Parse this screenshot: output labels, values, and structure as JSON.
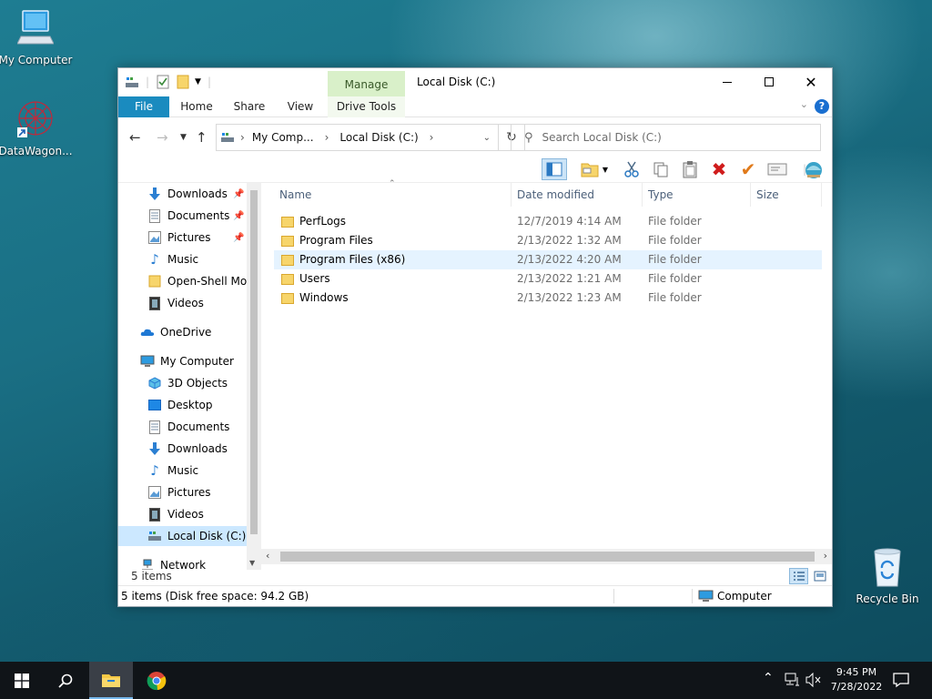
{
  "desktop": {
    "icons": [
      {
        "label": "My Computer"
      },
      {
        "label": "DataWagon..."
      },
      {
        "label": "Recycle Bin"
      }
    ]
  },
  "window": {
    "title": "Local Disk (C:)",
    "contextual_group": "Manage",
    "tabs": [
      "File",
      "Home",
      "Share",
      "View",
      "Drive Tools"
    ],
    "breadcrumb": [
      "My Comp...",
      "Local Disk (C:)"
    ],
    "search_placeholder": "Search Local Disk (C:)",
    "nav_items": [
      {
        "label": "Downloads",
        "icon": "downloads-icon",
        "pinned": true
      },
      {
        "label": "Documents",
        "icon": "documents-icon",
        "pinned": true
      },
      {
        "label": "Pictures",
        "icon": "pictures-icon",
        "pinned": true
      },
      {
        "label": "Music",
        "icon": "music-icon",
        "pinned": false
      },
      {
        "label": "Open-Shell Mod",
        "icon": "folder-icon",
        "pinned": false
      },
      {
        "label": "Videos",
        "icon": "videos-icon",
        "pinned": false
      },
      {
        "label": "OneDrive",
        "icon": "onedrive-icon",
        "pinned": false
      },
      {
        "label": "My Computer",
        "icon": "computer-icon",
        "pinned": false
      },
      {
        "label": "3D Objects",
        "icon": "3d-objects-icon",
        "pinned": false
      },
      {
        "label": "Desktop",
        "icon": "desktop-icon",
        "pinned": false
      },
      {
        "label": "Documents",
        "icon": "documents-icon",
        "pinned": false
      },
      {
        "label": "Downloads",
        "icon": "downloads-icon",
        "pinned": false
      },
      {
        "label": "Music",
        "icon": "music-icon",
        "pinned": false
      },
      {
        "label": "Pictures",
        "icon": "pictures-icon",
        "pinned": false
      },
      {
        "label": "Videos",
        "icon": "videos-icon",
        "pinned": false
      },
      {
        "label": "Local Disk (C:)",
        "icon": "drive-icon",
        "pinned": false
      },
      {
        "label": "Network",
        "icon": "network-icon",
        "pinned": false
      }
    ],
    "selected_nav": "Local Disk (C:)",
    "columns": [
      "Name",
      "Date modified",
      "Type",
      "Size"
    ],
    "files": [
      {
        "name": "PerfLogs",
        "date": "12/7/2019 4:14 AM",
        "type": "File folder"
      },
      {
        "name": "Program Files",
        "date": "2/13/2022 1:32 AM",
        "type": "File folder"
      },
      {
        "name": "Program Files (x86)",
        "date": "2/13/2022 4:20 AM",
        "type": "File folder"
      },
      {
        "name": "Users",
        "date": "2/13/2022 1:21 AM",
        "type": "File folder"
      },
      {
        "name": "Windows",
        "date": "2/13/2022 1:23 AM",
        "type": "File folder"
      }
    ],
    "highlighted_row": 2,
    "item_count": "5 items",
    "status_left": "5 items (Disk free space: 94.2 GB)",
    "status_right": "Computer"
  },
  "taskbar": {
    "time": "9:45 PM",
    "date": "7/28/2022"
  },
  "colors": {
    "file_tab": "#1a8bbf",
    "manage_group": "#d9f0c9",
    "selection": "#e5f3ff",
    "taskbar": "#101418"
  }
}
